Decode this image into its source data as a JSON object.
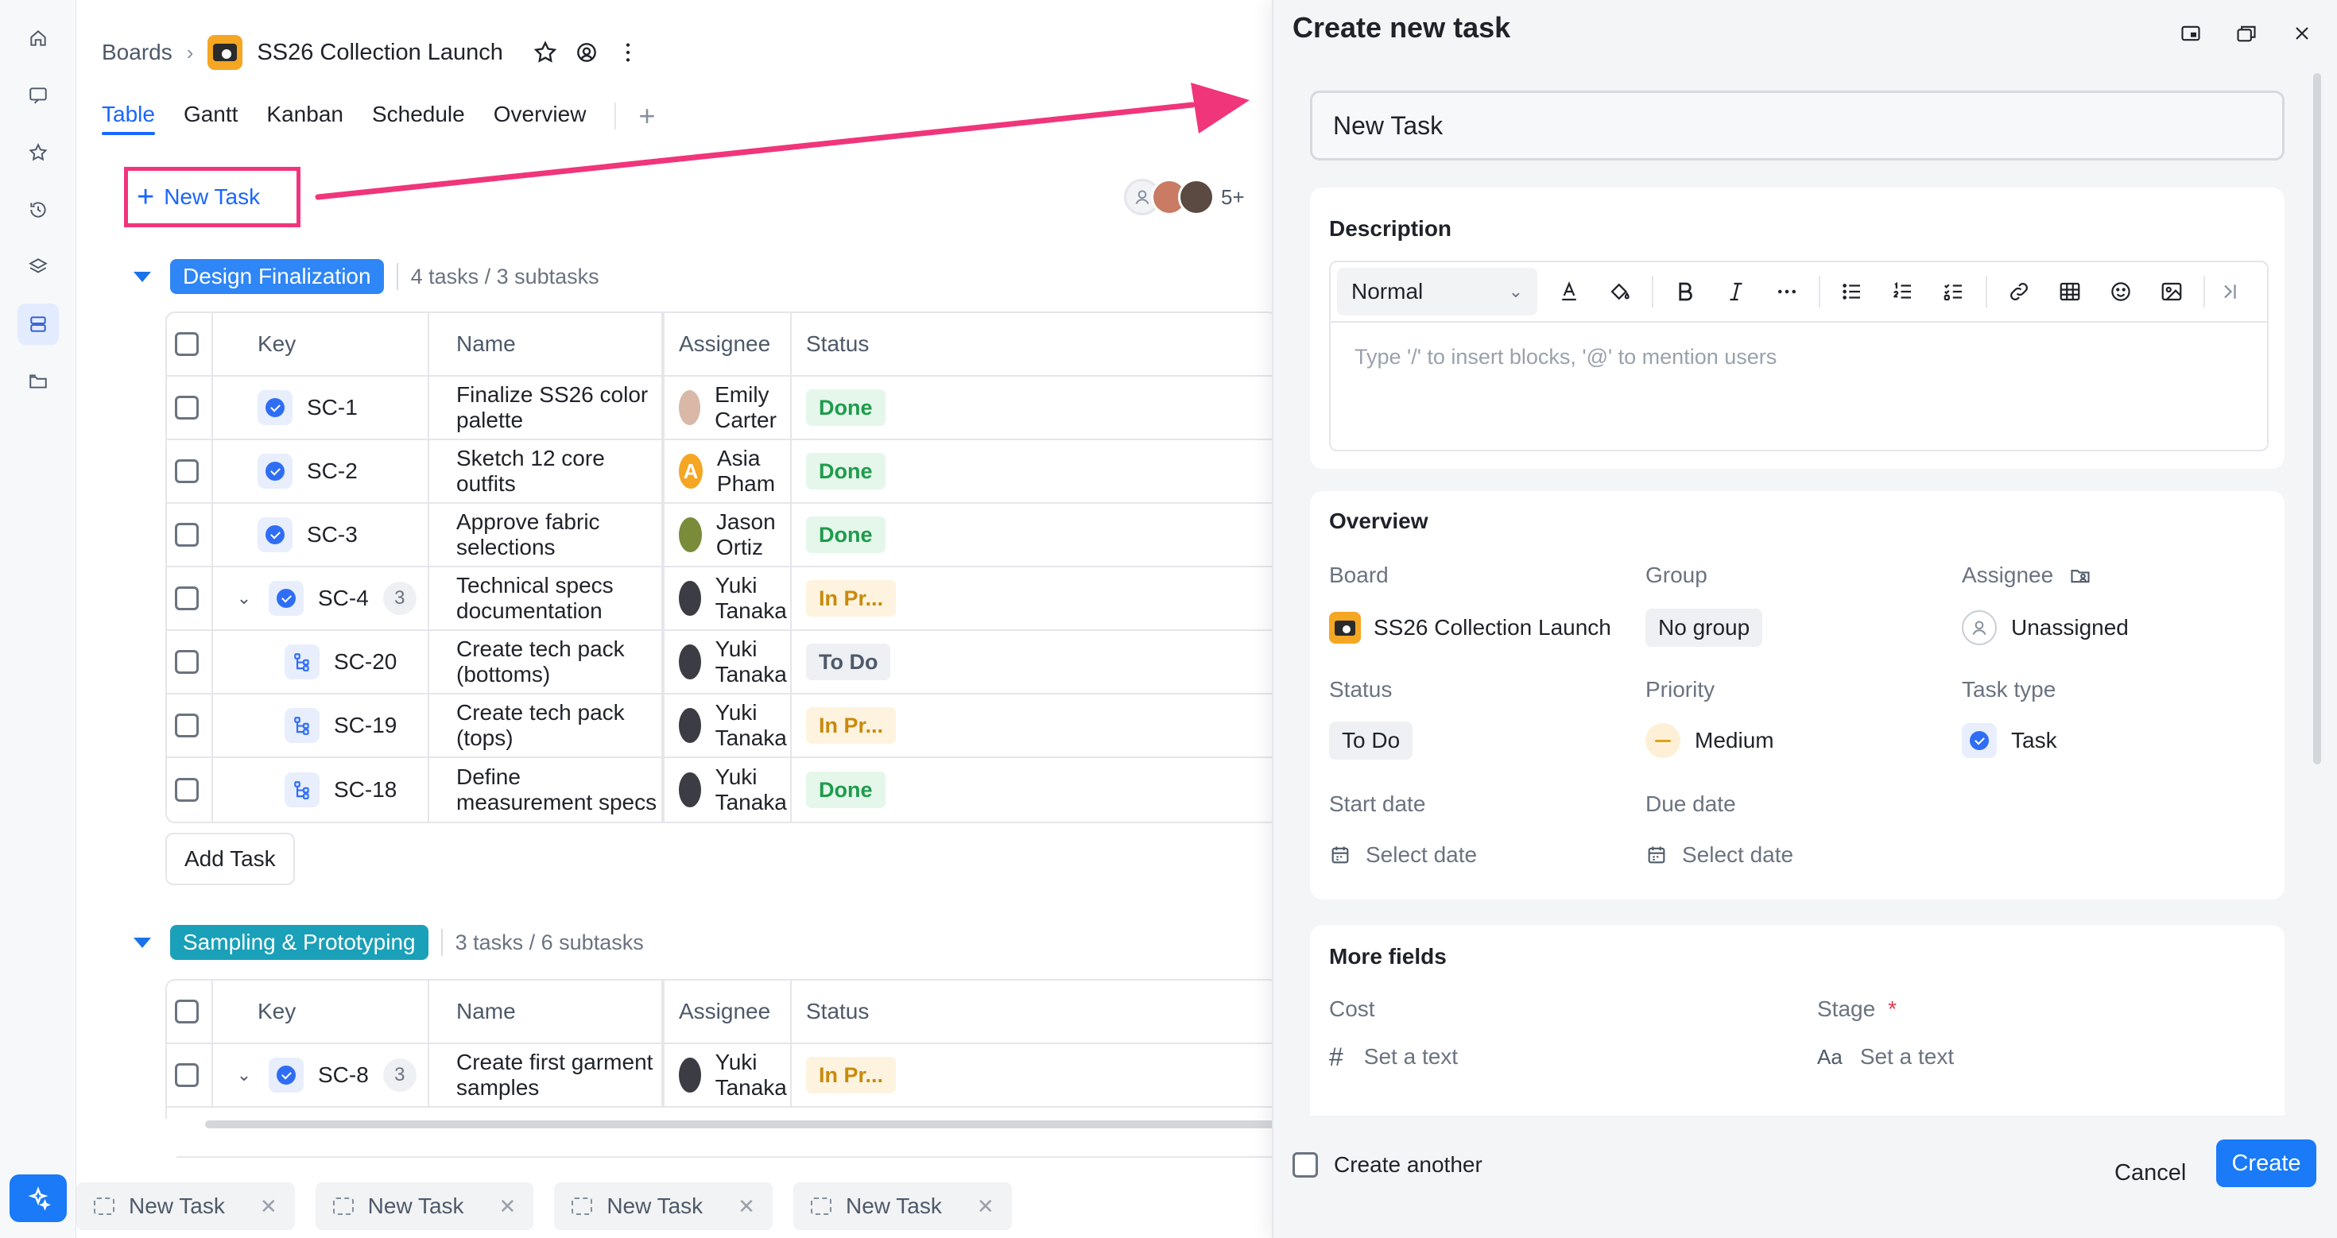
{
  "breadcrumb": {
    "root": "Boards",
    "board": "SS26 Collection Launch"
  },
  "tabs": [
    "Table",
    "Gantt",
    "Kanban",
    "Schedule",
    "Overview"
  ],
  "toolbar": {
    "new_task": "New Task",
    "members_more": "5+"
  },
  "columns": {
    "key": "Key",
    "name": "Name",
    "assignee": "Assignee",
    "status": "Status"
  },
  "group1": {
    "name": "Design Finalization",
    "count": "4 tasks / 3 subtasks",
    "color": "#2f86f6",
    "rows": [
      {
        "key": "SC-1",
        "name": "Finalize SS26 color palette",
        "assignee": "Emily Carter",
        "status": "Done"
      },
      {
        "key": "SC-2",
        "name": "Sketch 12 core outfits",
        "assignee": "Asia Pham",
        "status": "Done"
      },
      {
        "key": "SC-3",
        "name": "Approve fabric selections",
        "assignee": "Jason Ortiz",
        "status": "Done"
      },
      {
        "key": "SC-4",
        "name": "Technical specs documentation",
        "assignee": "Yuki Tanaka",
        "status": "In Pr...",
        "subcount": "3"
      },
      {
        "key": "SC-20",
        "name": "Create tech pack (bottoms)",
        "assignee": "Yuki Tanaka",
        "status": "To Do"
      },
      {
        "key": "SC-19",
        "name": "Create tech pack (tops)",
        "assignee": "Yuki Tanaka",
        "status": "In Pr..."
      },
      {
        "key": "SC-18",
        "name": "Define measurement specs",
        "assignee": "Yuki Tanaka",
        "status": "Done"
      }
    ],
    "add_task": "Add Task"
  },
  "group2": {
    "name": "Sampling & Prototyping",
    "count": "3 tasks / 6 subtasks",
    "color": "#1aa0b8",
    "rows": [
      {
        "key": "SC-8",
        "name": "Create first garment samples",
        "assignee": "Yuki Tanaka",
        "status": "In Pr...",
        "subcount": "3"
      }
    ]
  },
  "bottom_tabs": [
    "New Task",
    "New Task",
    "New Task",
    "New Task"
  ],
  "panel": {
    "title": "Create new task",
    "name_value": "New Task",
    "description_title": "Description",
    "format_select": "Normal",
    "editor_placeholder": "Type '/' to insert blocks, '@' to mention users",
    "overview_title": "Overview",
    "labels": {
      "board": "Board",
      "group": "Group",
      "assignee": "Assignee",
      "status": "Status",
      "priority": "Priority",
      "task_type": "Task type",
      "start_date": "Start date",
      "due_date": "Due date"
    },
    "values": {
      "board": "SS26 Collection Launch",
      "group": "No group",
      "assignee": "Unassigned",
      "status": "To Do",
      "priority": "Medium",
      "task_type": "Task",
      "start_date": "Select date",
      "due_date": "Select date"
    },
    "more_fields_title": "More fields",
    "more": {
      "cost_label": "Cost",
      "cost_placeholder": "Set a text",
      "stage_label": "Stage",
      "stage_required": "*",
      "stage_placeholder": "Set a text",
      "stage_icon": "Aa"
    },
    "create_another": "Create another",
    "cancel": "Cancel",
    "create": "Create"
  },
  "colors": {
    "accent": "#1a66ff",
    "highlight": "#f0357a",
    "done": "#1f9b4c",
    "in_progress": "#c98a0b"
  }
}
